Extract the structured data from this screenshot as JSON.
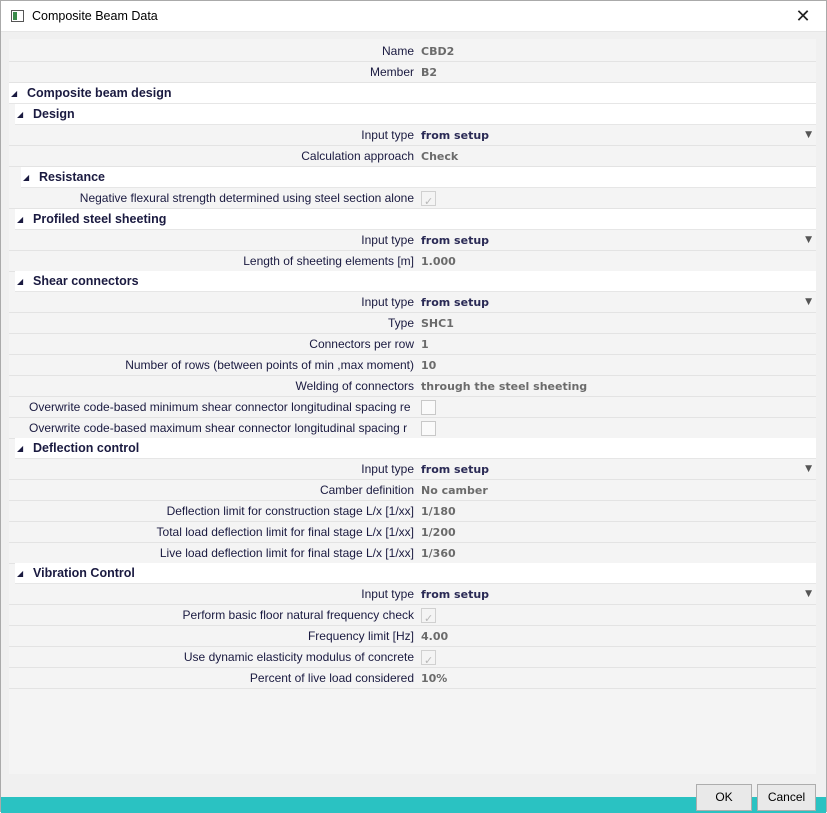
{
  "window": {
    "title": "Composite Beam Data",
    "title_icon": "app-window-icon",
    "close_icon": "close-icon"
  },
  "top": [
    {
      "label": "Name",
      "value": "CBD2"
    },
    {
      "label": "Member",
      "value": "B2"
    }
  ],
  "sections": {
    "composite": "Composite beam design",
    "design": "Design",
    "resistance": "Resistance",
    "sheeting": "Profiled steel sheeting",
    "shear": "Shear connectors",
    "deflection": "Deflection control",
    "vibration": "Vibration Control"
  },
  "design": {
    "input_type": {
      "label": "Input type",
      "value": "from setup"
    },
    "calc_approach": {
      "label": "Calculation approach",
      "value": "Check"
    }
  },
  "resistance": {
    "negative_flexural": {
      "label": "Negative flexural strength determined using steel section alone",
      "checked": true
    }
  },
  "sheeting": {
    "input_type": {
      "label": "Input type",
      "value": "from setup"
    },
    "length": {
      "label": "Length of sheeting elements [m]",
      "value": "1.000"
    }
  },
  "shear": {
    "input_type": {
      "label": "Input type",
      "value": "from setup"
    },
    "type": {
      "label": "Type",
      "value": "SHC1"
    },
    "per_row": {
      "label": "Connectors per row",
      "value": "1"
    },
    "rows": {
      "label": "Number of rows (between points of min ,max moment)",
      "value": "10"
    },
    "welding": {
      "label": "Welding of connectors",
      "value": "through the steel sheeting"
    },
    "min_spacing": {
      "label": "Overwrite code-based minimum shear connector longitudinal spacing re",
      "checked": false
    },
    "max_spacing": {
      "label": "Overwrite code-based maximum shear connector longitudinal spacing r",
      "checked": false
    }
  },
  "deflection": {
    "input_type": {
      "label": "Input type",
      "value": "from setup"
    },
    "camber": {
      "label": "Camber definition",
      "value": "No camber"
    },
    "construction": {
      "label": "Deflection limit for construction stage L/x [1/xx]",
      "value": "1/180"
    },
    "total": {
      "label": "Total load deflection limit for final stage L/x [1/xx]",
      "value": "1/200"
    },
    "live": {
      "label": "Live load deflection limit for final stage L/x [1/xx]",
      "value": "1/360"
    }
  },
  "vibration": {
    "input_type": {
      "label": "Input type",
      "value": "from setup"
    },
    "basic_check": {
      "label": "Perform basic floor natural frequency check",
      "checked": true
    },
    "freq_limit": {
      "label": "Frequency limit [Hz]",
      "value": "4.00"
    },
    "dynamic_modulus": {
      "label": "Use dynamic elasticity modulus of concrete",
      "checked": true
    },
    "percent_live": {
      "label": "Percent of live load considered",
      "value": "10%"
    }
  },
  "buttons": {
    "ok": "OK",
    "cancel": "Cancel"
  }
}
